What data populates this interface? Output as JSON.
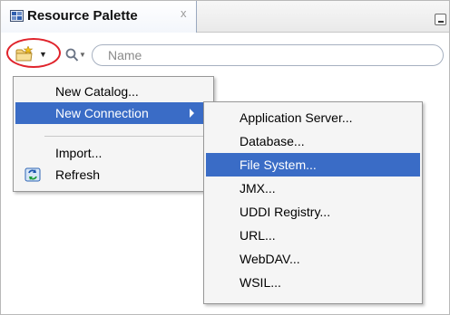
{
  "panel": {
    "title": "Resource Palette",
    "close_glyph": "x",
    "icons": {
      "tab": "resource-palette-icon",
      "minimize": "minimize-icon"
    }
  },
  "toolbar": {
    "new_button_icon": "folder-new-icon",
    "search_icon": "magnifier-icon",
    "search": {
      "placeholder": "Name",
      "value": ""
    },
    "highlight_color": "#e0242c"
  },
  "menu": {
    "items": [
      {
        "label": "New Catalog...",
        "selected": false
      },
      {
        "label": "New Connection",
        "selected": true,
        "has_submenu": true
      },
      {
        "label": "Import...",
        "selected": false
      },
      {
        "label": "Refresh",
        "icon": "refresh-icon",
        "selected": false
      }
    ]
  },
  "submenu": {
    "items": [
      {
        "label": "Application Server..."
      },
      {
        "label": "Database..."
      },
      {
        "label": "File System...",
        "selected": true
      },
      {
        "label": "JMX..."
      },
      {
        "label": "UDDI Registry..."
      },
      {
        "label": "URL..."
      },
      {
        "label": "WebDAV..."
      },
      {
        "label": "WSIL..."
      }
    ]
  },
  "colors": {
    "selection": "#3a6cc6",
    "menu_bg": "#f5f5f5"
  }
}
